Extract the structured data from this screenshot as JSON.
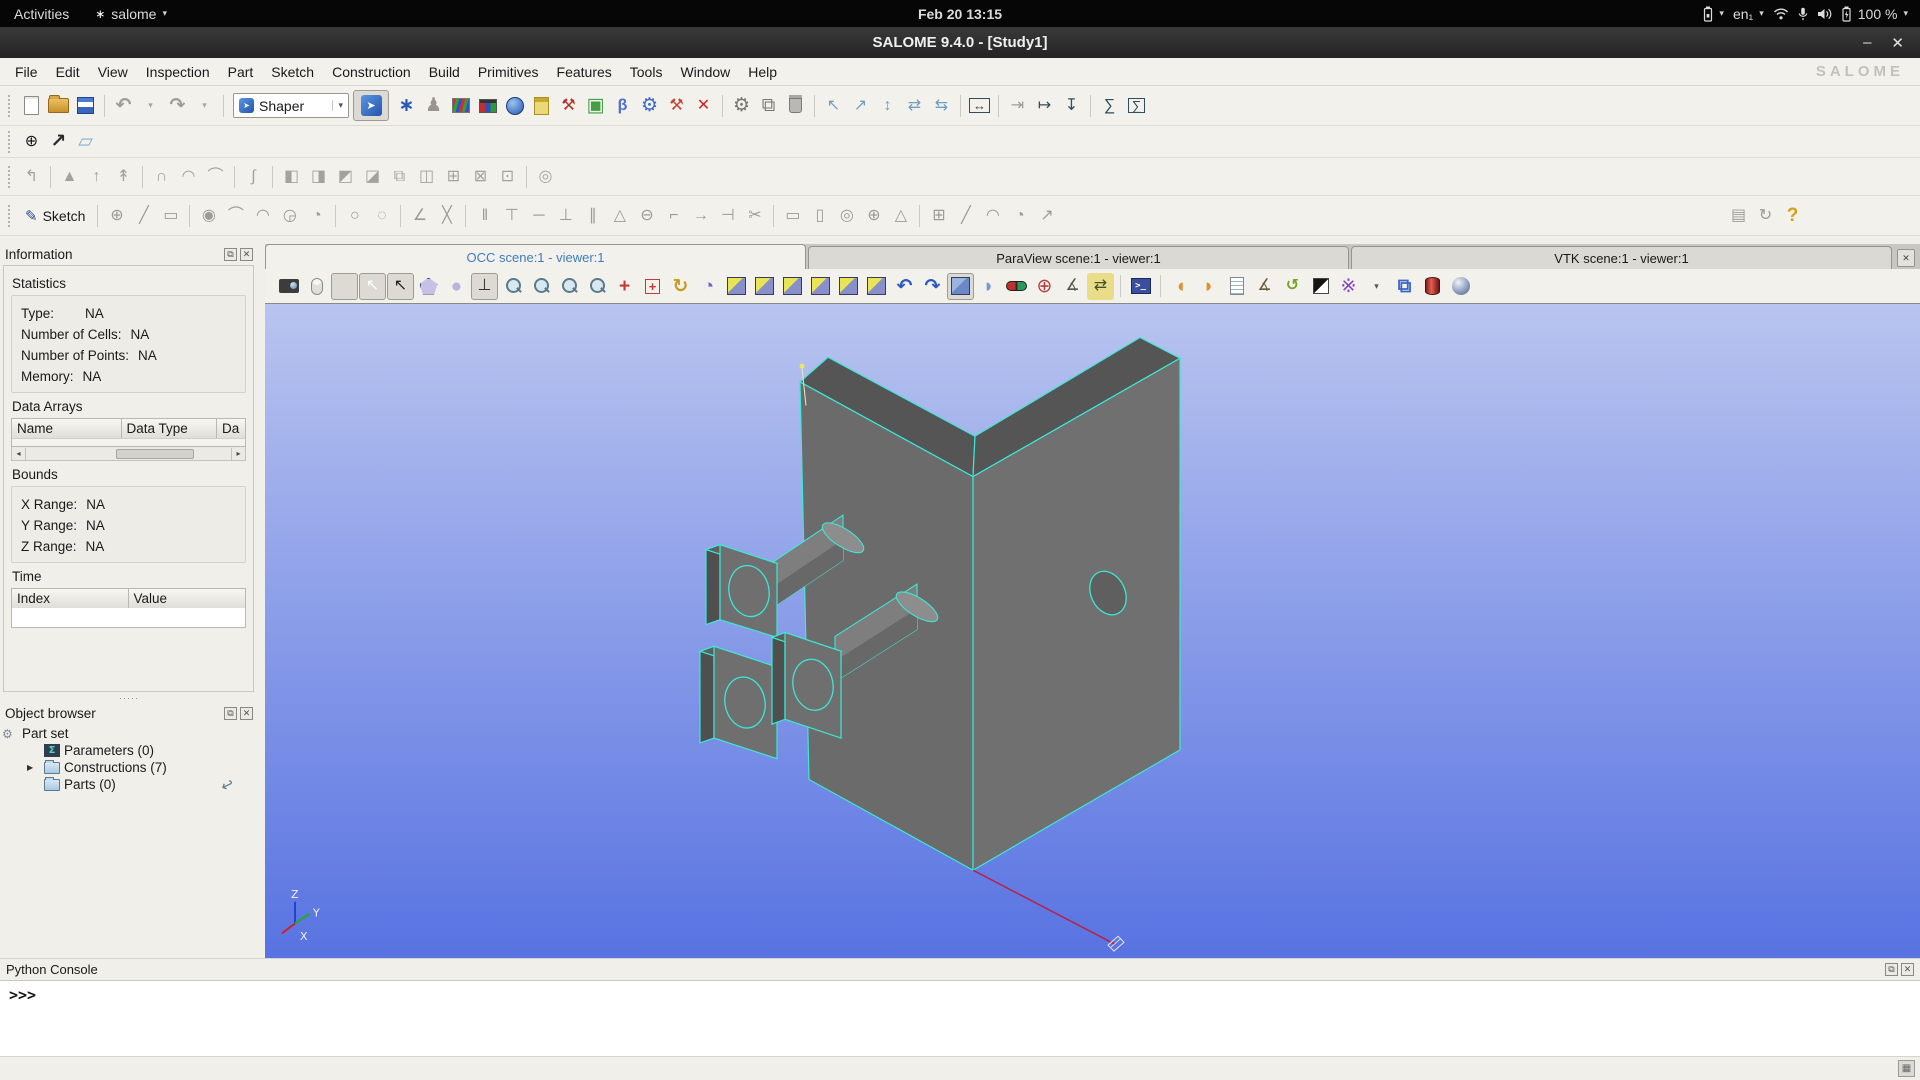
{
  "chrome": {
    "caret": "▾",
    "minimize": "–",
    "close": "✕",
    "float": "⧉",
    "dots": "·····",
    "left_scroll": "◂",
    "right_scroll": "▸",
    "expander": "▶",
    "prompt_caret": ">_"
  },
  "gnome": {
    "activities": "Activities",
    "app": "salome",
    "clock": "Feb 20 13:15",
    "keyboard": "en₁",
    "battery": "100 %"
  },
  "window": {
    "title": "SALOME 9.4.0 - [Study1]"
  },
  "menubar": {
    "items": [
      {
        "label": "File"
      },
      {
        "label": "Edit"
      },
      {
        "label": "View"
      },
      {
        "label": "Inspection"
      },
      {
        "label": "Part"
      },
      {
        "label": "Sketch"
      },
      {
        "label": "Construction"
      },
      {
        "label": "Build"
      },
      {
        "label": "Primitives"
      },
      {
        "label": "Features"
      },
      {
        "label": "Tools"
      },
      {
        "label": "Window"
      },
      {
        "label": "Help"
      }
    ],
    "watermark": "SALOME"
  },
  "toolbar": {
    "file": [
      {
        "n": "new-document-button",
        "cls": "page"
      },
      {
        "n": "open-document-button",
        "cls": "folderic"
      },
      {
        "n": "save-document-button",
        "cls": "saveic"
      },
      {
        "sep": 1
      },
      {
        "n": "undo-button",
        "g": "↶",
        "c": "#9d9d98",
        "cls": "bold big"
      },
      {
        "n": "undo-history-dropdown",
        "g": "▾",
        "c": "#a8a8a2",
        "cls": "mini"
      },
      {
        "n": "redo-button",
        "g": "↷",
        "c": "#9d9d98",
        "cls": "bold big"
      },
      {
        "n": "redo-history-dropdown",
        "g": "▾",
        "c": "#a8a8a2",
        "cls": "mini"
      },
      {
        "sep": 1
      }
    ],
    "shaper": {
      "label": "Shaper"
    },
    "modules": [
      {
        "n": "mesh-module-icon",
        "g": "∗",
        "c": "#2b5ab8",
        "cls": "bold big"
      },
      {
        "n": "sculpt-module-icon",
        "g": "♟",
        "c": "#99948e",
        "cls": "big"
      },
      {
        "n": "paravis-module-icon",
        "cls": "rgb"
      },
      {
        "n": "registry-module-icon",
        "cls": "reg"
      },
      {
        "n": "web-module-icon",
        "cls": "globe"
      },
      {
        "n": "notebook-icon",
        "cls": "note"
      },
      {
        "n": "tools-red-icon",
        "g": "⚒",
        "c": "#b23228"
      },
      {
        "n": "box-green-icon",
        "g": "▣",
        "c": "#44a044",
        "cls": "big"
      },
      {
        "n": "bias-icon",
        "g": "β",
        "c": "#4a6fd0",
        "cls": "bold"
      },
      {
        "n": "gear-blue-icon",
        "g": "⚙",
        "c": "#3a6ac8",
        "cls": "big"
      },
      {
        "n": "hammer-red-icon",
        "g": "⚒",
        "c": "#c0453a"
      },
      {
        "n": "split-red-icon",
        "g": "✕",
        "c": "#d02525",
        "cls": "bold"
      },
      {
        "sep": 1
      },
      {
        "n": "preferences-gear-icon",
        "g": "⚙",
        "c": "#77776f",
        "cls": "big"
      },
      {
        "n": "duplicate-icon",
        "g": "⧉",
        "c": "#77776f",
        "cls": "big"
      },
      {
        "n": "delete-icon",
        "cls": "trash"
      },
      {
        "sep": 1
      },
      {
        "n": "operation-transform-icon",
        "g": "↖",
        "c": "#6f9ec0"
      },
      {
        "n": "operation-move-icon",
        "g": "↗",
        "c": "#6f9ec0"
      },
      {
        "n": "operation-scale-icon",
        "g": "↕",
        "c": "#6f9ec0"
      },
      {
        "n": "operation-swap-icon",
        "g": "⇄",
        "c": "#6f9ec0"
      },
      {
        "n": "operation-exchange-icon",
        "g": "⇆",
        "c": "#6f9ec0"
      },
      {
        "sep": 1
      },
      {
        "n": "fit-width-icon",
        "g": "↔",
        "c": "#2e4e5e",
        "cls": "boxed"
      },
      {
        "sep": 1
      },
      {
        "n": "import-icon",
        "g": "⇥",
        "c": "#9d9d98"
      },
      {
        "n": "export-icon",
        "g": "↦",
        "c": "#2e4e5e"
      },
      {
        "n": "download-icon",
        "g": "↧",
        "c": "#2e4e5e"
      },
      {
        "sep": 1
      },
      {
        "n": "sum-icon",
        "g": "∑",
        "c": "#2e4e5e"
      },
      {
        "n": "sum-table-icon",
        "g": "∑",
        "c": "#2e4e5e",
        "cls": "boxed"
      }
    ],
    "small": [
      {
        "n": "snap-center-icon",
        "g": "⊕",
        "c": "#55555"
      },
      {
        "n": "vector-icon",
        "g": "↗",
        "c": "#2a2a2a",
        "cls": "bold big"
      },
      {
        "n": "plane-icon",
        "g": "▱",
        "c": "#7fb2d8",
        "cls": "big"
      }
    ],
    "features": [
      {
        "n": "feature-recover-icon",
        "g": "↰",
        "c": "#a3a39d"
      },
      {
        "sep": 1
      },
      {
        "n": "feature-extrude-icon",
        "g": "▲",
        "c": "#a3a39d"
      },
      {
        "n": "feature-extrude-cut-icon",
        "g": "↑",
        "c": "#a3a39d"
      },
      {
        "n": "feature-extrude-fuse-icon",
        "g": "↟",
        "c": "#a3a39d"
      },
      {
        "sep": 1
      },
      {
        "n": "feature-revolve-icon",
        "g": "∩",
        "c": "#a3a39d"
      },
      {
        "n": "feature-revolve-cut-icon",
        "g": "◠",
        "c": "#a3a39d"
      },
      {
        "n": "feature-revolve-fuse-icon",
        "g": "⌒",
        "c": "#a3a39d"
      },
      {
        "sep": 1
      },
      {
        "n": "feature-pipe-icon",
        "g": "∫",
        "c": "#a3a39d"
      },
      {
        "sep": 1
      },
      {
        "n": "boolean-cut-icon",
        "g": "◧",
        "c": "#a3a39d"
      },
      {
        "n": "boolean-fuse-icon",
        "g": "◨",
        "c": "#a3a39d"
      },
      {
        "n": "boolean-common-icon",
        "g": "◩",
        "c": "#a3a39d"
      },
      {
        "n": "boolean-smash-icon",
        "g": "◪",
        "c": "#a3a39d"
      },
      {
        "n": "boolean-fill-icon",
        "g": "⧉",
        "c": "#a3a39d"
      },
      {
        "n": "boolean-partition-icon",
        "g": "◫",
        "c": "#a3a39d"
      },
      {
        "n": "boolean-union-icon",
        "g": "⊞",
        "c": "#a3a39d"
      },
      {
        "n": "boolean-remove-icon",
        "g": "⊠",
        "c": "#a3a39d"
      },
      {
        "n": "boolean-intersect-icon",
        "g": "⊡",
        "c": "#a3a39d"
      },
      {
        "sep": 1
      },
      {
        "n": "feature-fillet-icon",
        "g": "◎",
        "c": "#a3a39d"
      }
    ],
    "sketch": {
      "label": "Sketch",
      "tools": [
        {
          "n": "sketch-point-icon",
          "g": "⊕",
          "c": "#9c9c96"
        },
        {
          "n": "sketch-line-icon",
          "g": "╱",
          "c": "#9c9c96"
        },
        {
          "n": "sketch-rectangle-icon",
          "g": "▭",
          "c": "#9c9c96"
        },
        {
          "sep": 1
        },
        {
          "n": "sketch-circle-icon",
          "g": "◉",
          "c": "#9c9c96"
        },
        {
          "n": "sketch-arc-icon",
          "g": "⌒",
          "c": "#9c9c96"
        },
        {
          "n": "sketch-arc-3pt-icon",
          "g": "◠",
          "c": "#9c9c96"
        },
        {
          "n": "sketch-arc-tangent-icon",
          "g": "◶",
          "c": "#9c9c96"
        },
        {
          "n": "sketch-arc-center-icon",
          "g": "◔",
          "c": "#9c9c96"
        },
        {
          "sep": 1
        },
        {
          "n": "sketch-circle-full-icon",
          "g": "○",
          "c": "#9c9c96"
        },
        {
          "n": "sketch-circle-dashed-icon",
          "g": "◌",
          "c": "#9c9c96"
        },
        {
          "sep": 1
        },
        {
          "n": "sketch-fillet-icon",
          "g": "∠",
          "c": "#9c9c96"
        },
        {
          "n": "sketch-split-icon",
          "g": "╳",
          "c": "#9c9c96"
        },
        {
          "sep": 1
        },
        {
          "n": "constraint-distance-icon",
          "g": "‖",
          "c": "#9c9c96"
        },
        {
          "n": "constraint-perpendicular-icon",
          "g": "⊤",
          "c": "#9c9c96"
        },
        {
          "n": "constraint-horizontal-icon",
          "g": "─",
          "c": "#9c9c96"
        },
        {
          "n": "constraint-vertical-icon",
          "g": "⊥",
          "c": "#9c9c96"
        },
        {
          "n": "constraint-parallel-icon",
          "g": "∥",
          "c": "#9c9c96"
        },
        {
          "n": "constraint-angle-icon",
          "g": "△",
          "c": "#9c9c96"
        },
        {
          "n": "constraint-radius-icon",
          "g": "⊖",
          "c": "#9c9c96"
        },
        {
          "n": "constraint-length-icon",
          "g": "⌐",
          "c": "#9c9c96"
        },
        {
          "n": "constraint-tangent-icon",
          "g": "→",
          "c": "#9c9c96"
        },
        {
          "n": "constraint-equal-icon",
          "g": "⊣",
          "c": "#9c9c96"
        },
        {
          "n": "sketch-trim-icon",
          "g": "✂",
          "c": "#9c9c96"
        },
        {
          "sep": 1
        },
        {
          "n": "sketch-projection-icon",
          "g": "▭",
          "c": "#9c9c96"
        },
        {
          "n": "sketch-face-icon",
          "g": "▯",
          "c": "#9c9c96"
        },
        {
          "n": "sketch-circle-sel-icon",
          "g": "◎",
          "c": "#9c9c96"
        },
        {
          "n": "sketch-point-sel-icon",
          "g": "⊕",
          "c": "#9c9c96"
        },
        {
          "n": "sketch-triangle-icon",
          "g": "△",
          "c": "#9c9c96"
        },
        {
          "sep": 1
        },
        {
          "n": "sketch-grid-icon",
          "g": "⊞",
          "c": "#9c9c96"
        },
        {
          "n": "sketch-diagonal-icon",
          "g": "╱",
          "c": "#9c9c96"
        },
        {
          "n": "sketch-arc-small-icon",
          "g": "◠",
          "c": "#9c9c96"
        },
        {
          "n": "sketch-pie-icon",
          "g": "◔",
          "c": "#9c9c96"
        },
        {
          "n": "sketch-vector-icon",
          "g": "↗",
          "c": "#9c9c96"
        }
      ],
      "tail": [
        {
          "n": "sketch-extra-icon",
          "g": "▤",
          "c": "#9c9c96"
        },
        {
          "n": "sketch-refresh-icon",
          "g": "↻",
          "c": "#9c9c96"
        }
      ],
      "help": {
        "n": "whats-this-help-button",
        "g": "?",
        "c": "#d8a018"
      }
    }
  },
  "tabs": {
    "items": [
      {
        "label": "OCC scene:1 - viewer:1"
      },
      {
        "label": "ParaView scene:1 - viewer:1"
      },
      {
        "label": "VTK scene:1 - viewer:1"
      }
    ]
  },
  "vp_toolbar": [
    {
      "n": "dump-view-button",
      "cls": "cam"
    },
    {
      "n": "mouse-binding-button",
      "cls": "mouse"
    },
    {
      "n": "zoom-cursor-button",
      "cls": "magx",
      "p": 1
    },
    {
      "n": "select-cursor-blue-button",
      "g": "↖",
      "c": "#ffffff",
      "bg": "#3d7bd0",
      "p": 1
    },
    {
      "n": "select-cursor-yellow-button",
      "g": "↖",
      "c": "#222222",
      "bg": "#d9c22a",
      "p": 1
    },
    {
      "n": "polygon-selection-button",
      "cls": "pent"
    },
    {
      "n": "circle-selection-button",
      "g": "●",
      "c": "#b9b3e0",
      "cls": "big"
    },
    {
      "n": "show-trihedron-button",
      "g": "⊥",
      "c": "#333333",
      "p": 1
    },
    {
      "n": "zoom-in-button",
      "cls": "mag"
    },
    {
      "n": "zoom-window-button",
      "cls": "mag"
    },
    {
      "n": "zoom-selection-button",
      "cls": "mag"
    },
    {
      "n": "fit-all-button",
      "cls": "mag"
    },
    {
      "n": "pan-button",
      "g": "+",
      "c": "#c23b34",
      "cls": "bold big"
    },
    {
      "n": "global-pan-button",
      "g": "+",
      "c": "#c23b34",
      "cls": "bold boxed"
    },
    {
      "n": "rotate-view-button",
      "g": "↻",
      "c": "#c79d1e",
      "cls": "bold big"
    },
    {
      "n": "change-viewpoint-button",
      "g": "◔",
      "c": "#7e5fc0",
      "cls": "big"
    },
    {
      "n": "front-view-button",
      "cls": "cube"
    },
    {
      "n": "back-view-button",
      "cls": "cube"
    },
    {
      "n": "top-view-button",
      "cls": "cube"
    },
    {
      "n": "bottom-view-button",
      "cls": "cube"
    },
    {
      "n": "left-view-button",
      "cls": "cube"
    },
    {
      "n": "right-view-button",
      "cls": "cube"
    },
    {
      "n": "view-undo-button",
      "g": "↶",
      "c": "#2a5ac0",
      "cls": "bold big"
    },
    {
      "n": "view-redo-button",
      "g": "↷",
      "c": "#2a5ac0",
      "cls": "bold big"
    },
    {
      "n": "isometric-view-button",
      "cls": "cube iso",
      "p": 1
    },
    {
      "n": "clipping-button",
      "g": "◗",
      "c": "#7a98d0",
      "cls": "big"
    },
    {
      "n": "stereo-view-button",
      "cls": "glasses"
    },
    {
      "n": "rotation-point-button",
      "g": "⊕",
      "c": "#b04040",
      "cls": "big"
    },
    {
      "n": "graduated-axes-button",
      "g": "∡",
      "c": "#555555"
    },
    {
      "n": "update-rate-button",
      "g": "⇄",
      "c": "#44531f",
      "bg": "#e9dd8a"
    },
    {
      "sep": 1
    },
    {
      "n": "python-console-window-button",
      "g": ">_",
      "cls": "conwin"
    },
    {
      "sep": 1
    },
    {
      "n": "preset-views-left-icon",
      "g": "◖",
      "c": "#df9030",
      "cls": "big"
    },
    {
      "n": "preset-views-right-icon",
      "g": "◗",
      "c": "#df9030",
      "cls": "big"
    },
    {
      "n": "scene-settings-button",
      "cls": "sheet"
    },
    {
      "n": "measurement-button",
      "g": "∡",
      "c": "#6b5b37"
    },
    {
      "n": "auto-rotation-button",
      "g": "↺",
      "c": "#76a41f",
      "cls": "bold"
    },
    {
      "n": "background-color-button",
      "cls": "bw"
    },
    {
      "n": "shortcuts-button",
      "g": "※",
      "c": "#8040c0",
      "cls": "big"
    },
    {
      "n": "shortcuts-dropdown",
      "g": "▾",
      "c": "#555555",
      "cls": "mini"
    },
    {
      "n": "windows-layout-button",
      "g": "⧉",
      "c": "#3a66c8",
      "cls": "bold big"
    },
    {
      "n": "cylinder-display-button",
      "cls": "redcyl"
    },
    {
      "n": "sphere-display-button",
      "cls": "sphere"
    }
  ],
  "left": {
    "info": {
      "title": "Information",
      "stats": {
        "label": "Statistics",
        "rows": [
          [
            "Type:",
            "NA"
          ],
          [
            "Number of Cells:",
            "NA"
          ],
          [
            "Number of Points:",
            "NA"
          ],
          [
            "Memory:",
            "NA"
          ]
        ]
      },
      "arrays": {
        "label": "Data Arrays",
        "columns": [
          "Name",
          "Data Type",
          "Da"
        ]
      },
      "bounds": {
        "label": "Bounds",
        "rows": [
          [
            "X Range:",
            "NA"
          ],
          [
            "Y Range:",
            "NA"
          ],
          [
            "Z Range:",
            "NA"
          ]
        ]
      },
      "time": {
        "label": "Time",
        "columns": [
          "Index",
          "Value"
        ]
      }
    },
    "browser": {
      "title": "Object browser",
      "items": [
        {
          "label": "Part set"
        },
        {
          "label": "Parameters (0)"
        },
        {
          "label": "Constructions (7)"
        },
        {
          "label": "Parts (0)"
        }
      ]
    }
  },
  "viewport": {
    "axes": {
      "x": "X",
      "y": "Y",
      "z": "Z"
    }
  },
  "console": {
    "title": "Python Console",
    "prompt": ">>>"
  },
  "theme": {
    "accent": "#3f7dbe",
    "vp-top": "#b9c4ef",
    "vp-bottom": "#5873e2",
    "edge": "#3be8d6",
    "face": "#6b6b6b",
    "face2": "#707070",
    "top-face": "#555555",
    "red-line": "#b5234a"
  }
}
